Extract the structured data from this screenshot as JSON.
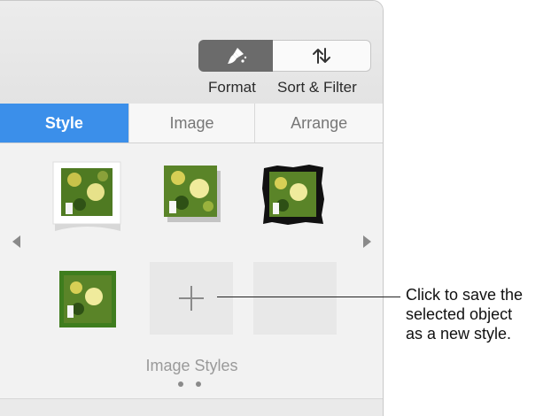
{
  "toolbar": {
    "format_label": "Format",
    "sort_filter_label": "Sort & Filter",
    "format_icon": "paintbrush-icon",
    "sort_icon": "sort-arrows-icon"
  },
  "tabs": [
    {
      "label": "Style",
      "active": true
    },
    {
      "label": "Image",
      "active": false
    },
    {
      "label": "Arrange",
      "active": false
    }
  ],
  "image_styles": {
    "label": "Image Styles",
    "thumbnails": [
      {
        "style": "white-frame-with-curl"
      },
      {
        "style": "drop-shadow"
      },
      {
        "style": "rough-black-border"
      },
      {
        "style": "green-bevel"
      }
    ],
    "add_button_icon": "plus-icon",
    "page_count": 2
  },
  "callout": {
    "lines": [
      "Click to save the",
      "selected object",
      "as a new style."
    ]
  },
  "colors": {
    "accent": "#3b8fea",
    "format_button": "#6b6b6b"
  }
}
